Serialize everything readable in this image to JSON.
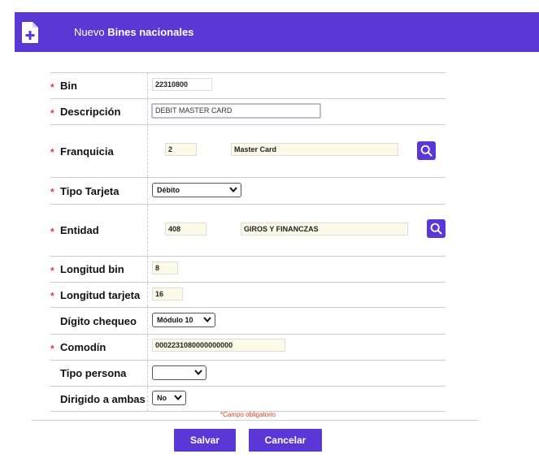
{
  "header": {
    "title_prefix": "Nuevo",
    "title_bold": "Bines nacionales",
    "icon": "file-plus-icon",
    "background": "#5b37d6"
  },
  "form": {
    "required_mark": "*",
    "bin": {
      "label": "Bin",
      "value": "22310800"
    },
    "descripcion": {
      "label": "Descripción",
      "value": "DEBIT MASTER CARD"
    },
    "franquicia": {
      "label": "Franquicia",
      "code": "2",
      "name": "Master Card"
    },
    "tipo_tarjeta": {
      "label": "Tipo Tarjeta",
      "selected": "Débito"
    },
    "entidad": {
      "label": "Entidad",
      "code": "408",
      "name": "GIROS Y FINANCZAS"
    },
    "longitud_bin": {
      "label": "Longitud bin",
      "value": "8"
    },
    "longitud_tarjeta": {
      "label": "Longitud tarjeta",
      "value": "16"
    },
    "digito_chequeo": {
      "label": "Dígito chequeo",
      "selected": "Módulo 10"
    },
    "comodin": {
      "label": "Comodín",
      "value": "0002231080000000000"
    },
    "tipo_persona": {
      "label": "Tipo persona",
      "selected": ""
    },
    "dirigido_a_ambas": {
      "label": "Dirigido a ambas",
      "selected": "No"
    }
  },
  "required_note": "*Campo obligatorio",
  "buttons": {
    "save": "Salvar",
    "cancel": "Cancelar"
  },
  "colors": {
    "accent": "#5b37d6",
    "required": "#e53b1e",
    "input_background": "#fbfbe8"
  }
}
